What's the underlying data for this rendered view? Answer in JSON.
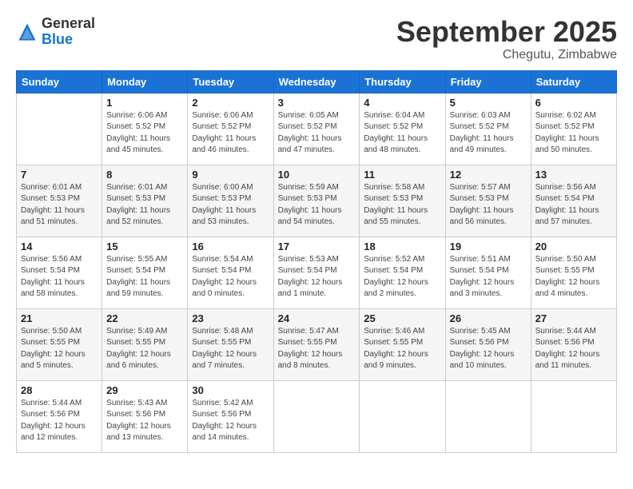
{
  "logo": {
    "general": "General",
    "blue": "Blue"
  },
  "title": {
    "month": "September 2025",
    "location": "Chegutu, Zimbabwe"
  },
  "headers": [
    "Sunday",
    "Monday",
    "Tuesday",
    "Wednesday",
    "Thursday",
    "Friday",
    "Saturday"
  ],
  "weeks": [
    [
      {
        "day": "",
        "sunrise": "",
        "sunset": "",
        "daylight": ""
      },
      {
        "day": "1",
        "sunrise": "Sunrise: 6:06 AM",
        "sunset": "Sunset: 5:52 PM",
        "daylight": "Daylight: 11 hours and 45 minutes."
      },
      {
        "day": "2",
        "sunrise": "Sunrise: 6:06 AM",
        "sunset": "Sunset: 5:52 PM",
        "daylight": "Daylight: 11 hours and 46 minutes."
      },
      {
        "day": "3",
        "sunrise": "Sunrise: 6:05 AM",
        "sunset": "Sunset: 5:52 PM",
        "daylight": "Daylight: 11 hours and 47 minutes."
      },
      {
        "day": "4",
        "sunrise": "Sunrise: 6:04 AM",
        "sunset": "Sunset: 5:52 PM",
        "daylight": "Daylight: 11 hours and 48 minutes."
      },
      {
        "day": "5",
        "sunrise": "Sunrise: 6:03 AM",
        "sunset": "Sunset: 5:52 PM",
        "daylight": "Daylight: 11 hours and 49 minutes."
      },
      {
        "day": "6",
        "sunrise": "Sunrise: 6:02 AM",
        "sunset": "Sunset: 5:52 PM",
        "daylight": "Daylight: 11 hours and 50 minutes."
      }
    ],
    [
      {
        "day": "7",
        "sunrise": "Sunrise: 6:01 AM",
        "sunset": "Sunset: 5:53 PM",
        "daylight": "Daylight: 11 hours and 51 minutes."
      },
      {
        "day": "8",
        "sunrise": "Sunrise: 6:01 AM",
        "sunset": "Sunset: 5:53 PM",
        "daylight": "Daylight: 11 hours and 52 minutes."
      },
      {
        "day": "9",
        "sunrise": "Sunrise: 6:00 AM",
        "sunset": "Sunset: 5:53 PM",
        "daylight": "Daylight: 11 hours and 53 minutes."
      },
      {
        "day": "10",
        "sunrise": "Sunrise: 5:59 AM",
        "sunset": "Sunset: 5:53 PM",
        "daylight": "Daylight: 11 hours and 54 minutes."
      },
      {
        "day": "11",
        "sunrise": "Sunrise: 5:58 AM",
        "sunset": "Sunset: 5:53 PM",
        "daylight": "Daylight: 11 hours and 55 minutes."
      },
      {
        "day": "12",
        "sunrise": "Sunrise: 5:57 AM",
        "sunset": "Sunset: 5:53 PM",
        "daylight": "Daylight: 11 hours and 56 minutes."
      },
      {
        "day": "13",
        "sunrise": "Sunrise: 5:56 AM",
        "sunset": "Sunset: 5:54 PM",
        "daylight": "Daylight: 11 hours and 57 minutes."
      }
    ],
    [
      {
        "day": "14",
        "sunrise": "Sunrise: 5:56 AM",
        "sunset": "Sunset: 5:54 PM",
        "daylight": "Daylight: 11 hours and 58 minutes."
      },
      {
        "day": "15",
        "sunrise": "Sunrise: 5:55 AM",
        "sunset": "Sunset: 5:54 PM",
        "daylight": "Daylight: 11 hours and 59 minutes."
      },
      {
        "day": "16",
        "sunrise": "Sunrise: 5:54 AM",
        "sunset": "Sunset: 5:54 PM",
        "daylight": "Daylight: 12 hours and 0 minutes."
      },
      {
        "day": "17",
        "sunrise": "Sunrise: 5:53 AM",
        "sunset": "Sunset: 5:54 PM",
        "daylight": "Daylight: 12 hours and 1 minute."
      },
      {
        "day": "18",
        "sunrise": "Sunrise: 5:52 AM",
        "sunset": "Sunset: 5:54 PM",
        "daylight": "Daylight: 12 hours and 2 minutes."
      },
      {
        "day": "19",
        "sunrise": "Sunrise: 5:51 AM",
        "sunset": "Sunset: 5:54 PM",
        "daylight": "Daylight: 12 hours and 3 minutes."
      },
      {
        "day": "20",
        "sunrise": "Sunrise: 5:50 AM",
        "sunset": "Sunset: 5:55 PM",
        "daylight": "Daylight: 12 hours and 4 minutes."
      }
    ],
    [
      {
        "day": "21",
        "sunrise": "Sunrise: 5:50 AM",
        "sunset": "Sunset: 5:55 PM",
        "daylight": "Daylight: 12 hours and 5 minutes."
      },
      {
        "day": "22",
        "sunrise": "Sunrise: 5:49 AM",
        "sunset": "Sunset: 5:55 PM",
        "daylight": "Daylight: 12 hours and 6 minutes."
      },
      {
        "day": "23",
        "sunrise": "Sunrise: 5:48 AM",
        "sunset": "Sunset: 5:55 PM",
        "daylight": "Daylight: 12 hours and 7 minutes."
      },
      {
        "day": "24",
        "sunrise": "Sunrise: 5:47 AM",
        "sunset": "Sunset: 5:55 PM",
        "daylight": "Daylight: 12 hours and 8 minutes."
      },
      {
        "day": "25",
        "sunrise": "Sunrise: 5:46 AM",
        "sunset": "Sunset: 5:55 PM",
        "daylight": "Daylight: 12 hours and 9 minutes."
      },
      {
        "day": "26",
        "sunrise": "Sunrise: 5:45 AM",
        "sunset": "Sunset: 5:56 PM",
        "daylight": "Daylight: 12 hours and 10 minutes."
      },
      {
        "day": "27",
        "sunrise": "Sunrise: 5:44 AM",
        "sunset": "Sunset: 5:56 PM",
        "daylight": "Daylight: 12 hours and 11 minutes."
      }
    ],
    [
      {
        "day": "28",
        "sunrise": "Sunrise: 5:44 AM",
        "sunset": "Sunset: 5:56 PM",
        "daylight": "Daylight: 12 hours and 12 minutes."
      },
      {
        "day": "29",
        "sunrise": "Sunrise: 5:43 AM",
        "sunset": "Sunset: 5:56 PM",
        "daylight": "Daylight: 12 hours and 13 minutes."
      },
      {
        "day": "30",
        "sunrise": "Sunrise: 5:42 AM",
        "sunset": "Sunset: 5:56 PM",
        "daylight": "Daylight: 12 hours and 14 minutes."
      },
      {
        "day": "",
        "sunrise": "",
        "sunset": "",
        "daylight": ""
      },
      {
        "day": "",
        "sunrise": "",
        "sunset": "",
        "daylight": ""
      },
      {
        "day": "",
        "sunrise": "",
        "sunset": "",
        "daylight": ""
      },
      {
        "day": "",
        "sunrise": "",
        "sunset": "",
        "daylight": ""
      }
    ]
  ]
}
